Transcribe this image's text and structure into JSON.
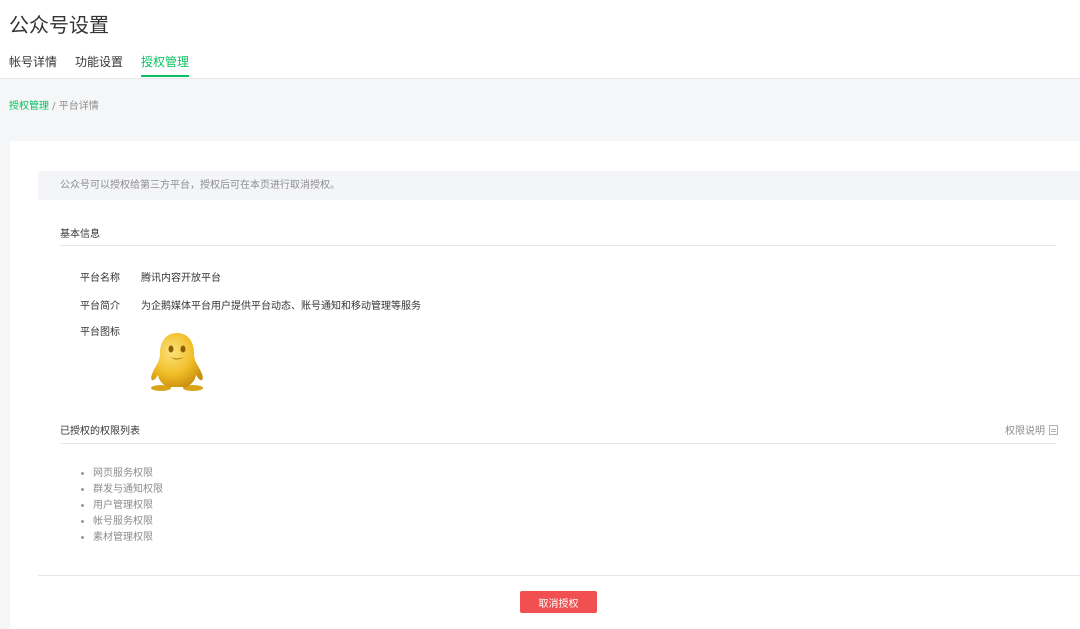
{
  "page": {
    "title": "公众号设置"
  },
  "tabs": [
    {
      "label": "帐号详情",
      "active": false
    },
    {
      "label": "功能设置",
      "active": false
    },
    {
      "label": "授权管理",
      "active": true
    }
  ],
  "breadcrumb": {
    "root": "授权管理",
    "separator": " / ",
    "current": "平台详情"
  },
  "notice": "公众号可以授权给第三方平台，授权后可在本页进行取消授权。",
  "basic_info": {
    "title": "基本信息",
    "name_label": "平台名称",
    "name_value": "腾讯内容开放平台",
    "desc_label": "平台简介",
    "desc_value": "为企鹅媒体平台用户提供平台动态、账号通知和移动管理等服务",
    "icon_label": "平台图标"
  },
  "permissions": {
    "title": "已授权的权限列表",
    "help_link": "权限说明",
    "items": [
      "网页服务权限",
      "群发与通知权限",
      "用户管理权限",
      "帐号服务权限",
      "素材管理权限"
    ]
  },
  "actions": {
    "cancel_label": "取消授权"
  },
  "colors": {
    "accent": "#07c160",
    "danger": "#f05050"
  }
}
